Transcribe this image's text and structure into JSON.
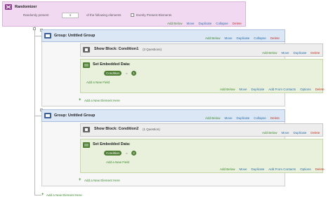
{
  "randomizer": {
    "title": "Randomizer",
    "present_label": "Randomly present",
    "count_value": "1",
    "of_label": "of the following elements",
    "evenly_label": "Evenly Present Elements",
    "actions": [
      "Add Below",
      "Move",
      "Duplicate",
      "Collapse",
      "Delete"
    ]
  },
  "groups": [
    {
      "title": "Group: Untitled Group",
      "actions": [
        "Add Below",
        "Move",
        "Duplicate",
        "Collapse",
        "Delete"
      ],
      "show_block": {
        "title": "Show Block: Condition1",
        "count": "(3 Questions)",
        "actions": [
          "Add Below",
          "Move",
          "Duplicate",
          "Delete"
        ]
      },
      "embedded": {
        "title": "Set Embedded Data:",
        "field_name": "Condition",
        "equals": "=",
        "field_value": "1",
        "add_field": "Add a New Field",
        "actions": [
          "Add Below",
          "Move",
          "Duplicate",
          "Add From Contacts",
          "Options",
          "Delete"
        ]
      },
      "add_element": "Add a New Element Here"
    },
    {
      "title": "Group: Untitled Group",
      "actions": [
        "Add Below",
        "Move",
        "Duplicate",
        "Collapse",
        "Delete"
      ],
      "show_block": {
        "title": "Show Block: Condition2",
        "count": "(1 Question)",
        "actions": [
          "Add Below",
          "Move",
          "Duplicate",
          "Delete"
        ]
      },
      "embedded": {
        "title": "Set Embedded Data:",
        "field_name": "Condition",
        "equals": "=",
        "field_value": "2",
        "add_field": "Add a New Field",
        "actions": [
          "Add Below",
          "Move",
          "Duplicate",
          "Add From Contacts",
          "Options",
          "Delete"
        ]
      },
      "add_element": "Add a New Element Here"
    }
  ],
  "root_add_element": "Add a New Element Here",
  "colors": {
    "randomizer_bg": "#f2d9f2",
    "group_bg": "#dce7f5",
    "embedded_bg": "#e9f1dc",
    "action_link": "#2a6fa8",
    "add_green": "#3c8a2e",
    "delete_red": "#c0392b",
    "pill_green": "#4e7d34"
  }
}
